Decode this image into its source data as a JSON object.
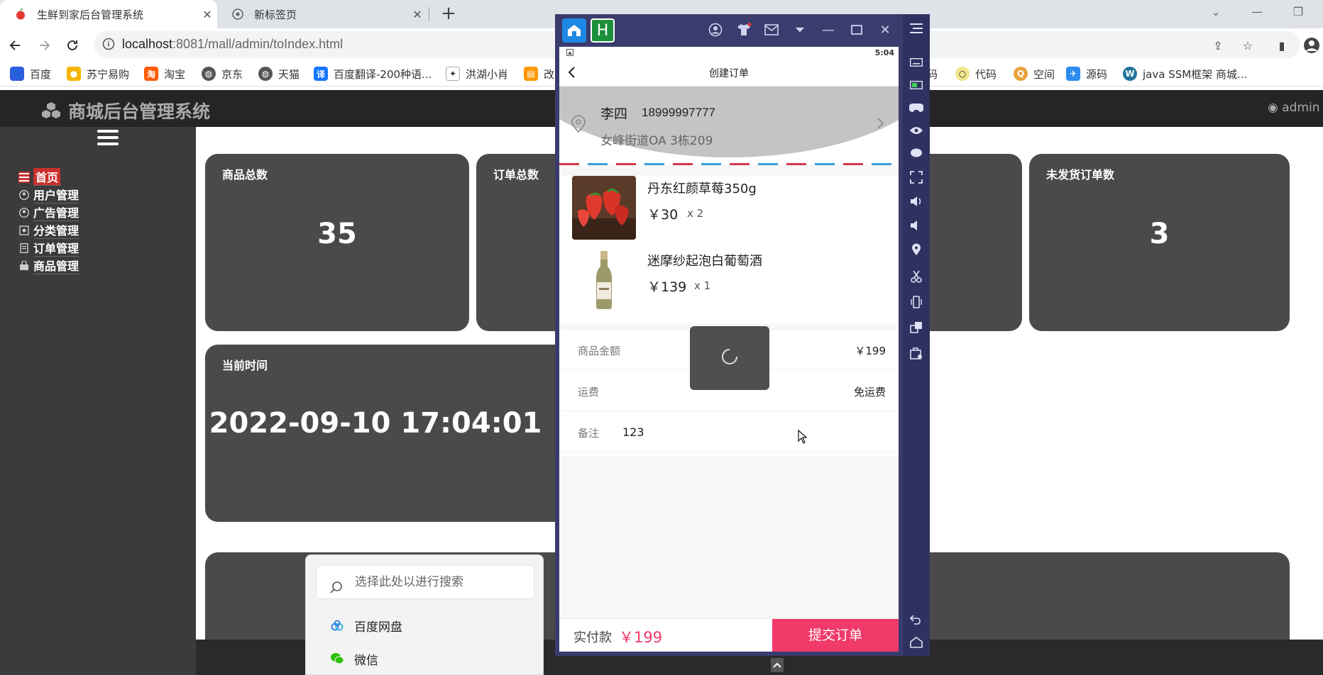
{
  "browser": {
    "tabs": [
      {
        "label": "生鲜到家后台管理系统",
        "active": true
      },
      {
        "label": "新标签页",
        "active": false
      }
    ],
    "url_host": "localhost",
    "url_rest": ":8081/mall/admin/toIndex.html",
    "bookmarks": [
      "百度",
      "苏宁易购",
      "淘宝",
      "京东",
      "天猫",
      "百度翻译-200种语...",
      "洪湖小肖",
      "改",
      "码",
      "代码",
      "空间",
      "源码",
      "java SSM框架 商城..."
    ]
  },
  "admin": {
    "title": "商城后台管理系统",
    "user": "admin",
    "menu": [
      "首页",
      "用户管理",
      "广告管理",
      "分类管理",
      "订单管理",
      "商品管理"
    ],
    "cards": {
      "goods_total_label": "商品总数",
      "goods_total_value": "35",
      "orders_total_label": "订单总数",
      "unshipped_label": "未发货订单数",
      "unshipped_value": "3",
      "time_label": "当前时间",
      "time_value": "2022-09-10 17:04:01"
    }
  },
  "startmenu": {
    "search_placeholder": "选择此处以进行搜索",
    "items": [
      "百度网盘",
      "微信"
    ]
  },
  "phone": {
    "time": "5:04",
    "page_title": "创建订单",
    "address": {
      "name": "李四",
      "phone": "18999997777",
      "detail": "女峰街道OA 3栋209"
    },
    "goods": [
      {
        "name": "丹东红颜草莓350g",
        "price": "￥30",
        "qty": "x 2"
      },
      {
        "name": "迷摩纱起泡白葡萄酒",
        "price": "￥139",
        "qty": "x 1"
      }
    ],
    "summary": {
      "amount_label": "商品金额",
      "amount_value": "￥199",
      "freight_label": "运费",
      "freight_value": "免运费",
      "memo_label": "备注",
      "memo_value": "123"
    },
    "pay": {
      "label": "实付款",
      "value": "￥199",
      "submit": "提交订单"
    }
  }
}
